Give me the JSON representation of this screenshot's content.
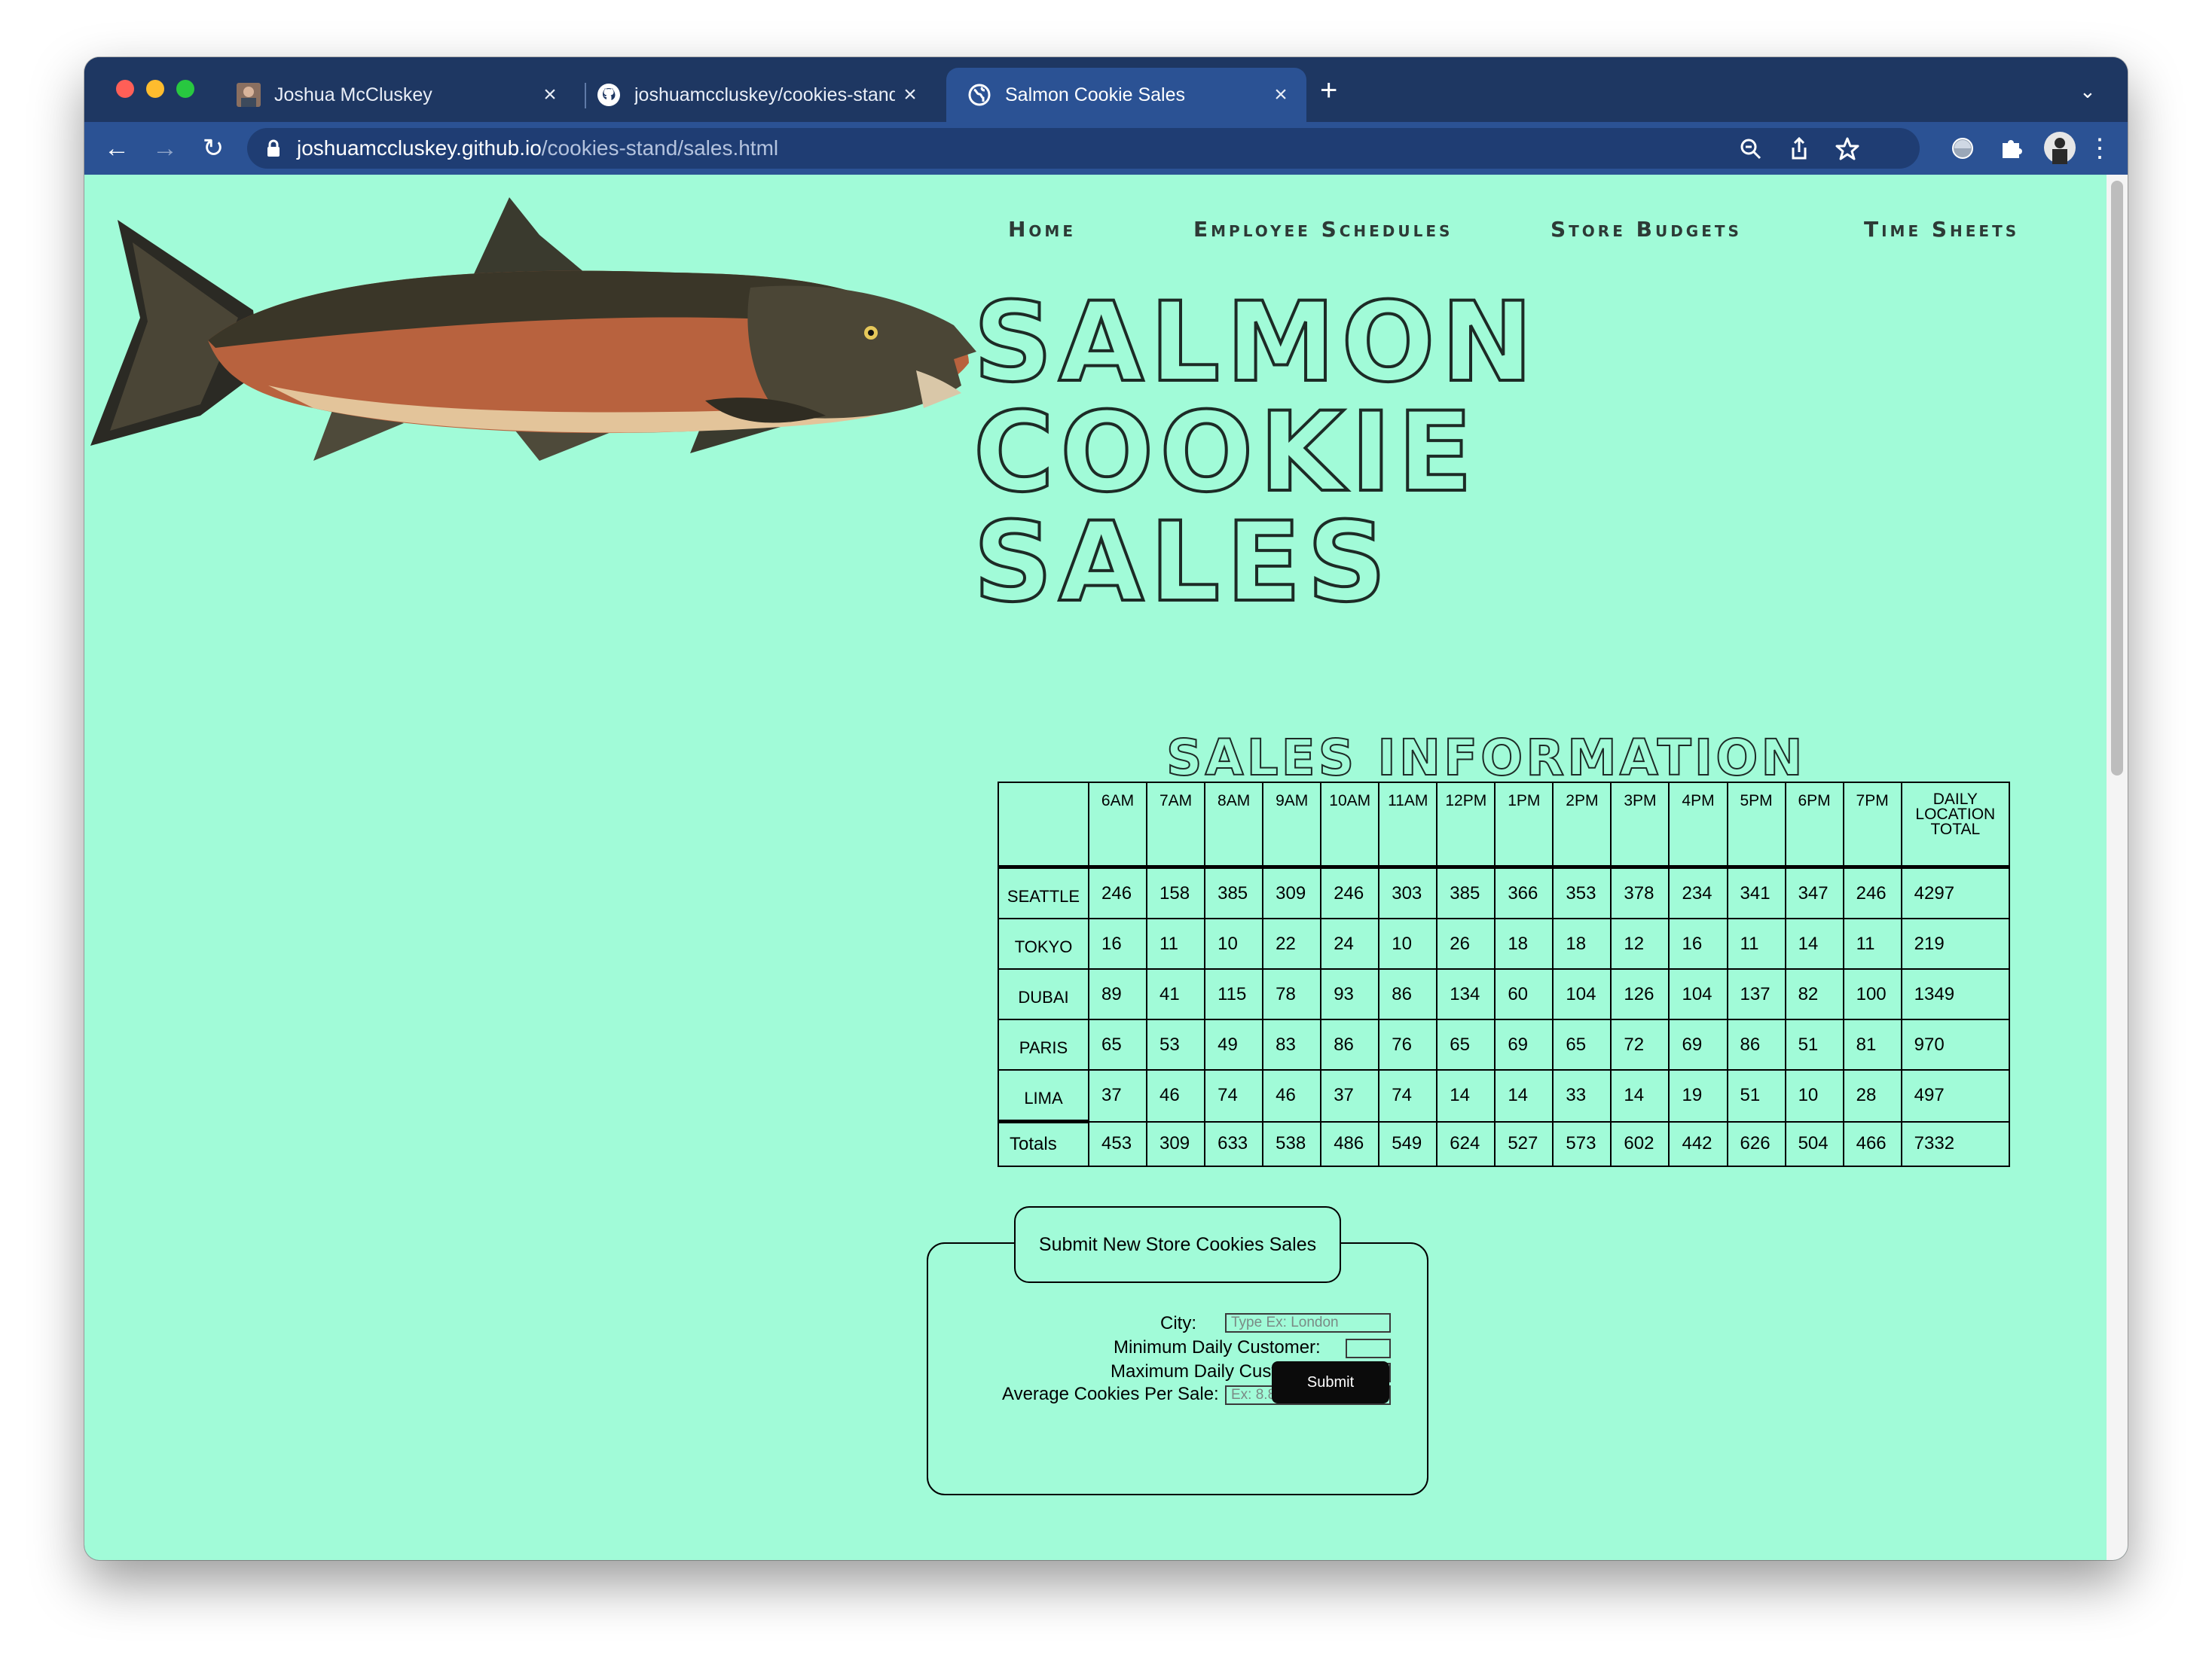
{
  "browser": {
    "tabs": [
      {
        "title": "Joshua McCluskey",
        "close": "×"
      },
      {
        "title": "joshuamccluskey/cookies-stand",
        "close": "×"
      },
      {
        "title": "Salmon Cookie Sales",
        "close": "×"
      }
    ],
    "new_tab": "+",
    "tab_menu": "⌄",
    "url_host": "joshuamccluskey.github.io",
    "url_path": "/cookies-stand/sales.html",
    "back": "←",
    "forward": "→",
    "reload": "↻",
    "menu": "⋮"
  },
  "nav": {
    "home": "Home",
    "employee_schedules": "Employee Schedules",
    "store_budgets": "Store Budgets",
    "time_sheets": "Time Sheets"
  },
  "hero": {
    "line1": "SALMON COOKIE",
    "line2": "SALES"
  },
  "sales": {
    "heading": "SALES INFORMATION",
    "hours": [
      "6AM",
      "7AM",
      "8AM",
      "9AM",
      "10AM",
      "11AM",
      "12PM",
      "1PM",
      "2PM",
      "3PM",
      "4PM",
      "5PM",
      "6PM",
      "7PM"
    ],
    "total_header": [
      "DAILY",
      "LOCATION",
      "TOTAL"
    ],
    "rows": [
      {
        "city": "SEATTLE",
        "values": [
          "246",
          "158",
          "385",
          "309",
          "246",
          "303",
          "385",
          "366",
          "353",
          "378",
          "234",
          "341",
          "347",
          "246"
        ],
        "total": "4297"
      },
      {
        "city": "TOKYO",
        "values": [
          "16",
          "11",
          "10",
          "22",
          "24",
          "10",
          "26",
          "18",
          "18",
          "12",
          "16",
          "11",
          "14",
          "11"
        ],
        "total": "219"
      },
      {
        "city": "DUBAI",
        "values": [
          "89",
          "41",
          "115",
          "78",
          "93",
          "86",
          "134",
          "60",
          "104",
          "126",
          "104",
          "137",
          "82",
          "100"
        ],
        "total": "1349"
      },
      {
        "city": "PARIS",
        "values": [
          "65",
          "53",
          "49",
          "83",
          "86",
          "76",
          "65",
          "69",
          "65",
          "72",
          "69",
          "86",
          "51",
          "81"
        ],
        "total": "970"
      },
      {
        "city": "LIMA",
        "values": [
          "37",
          "46",
          "74",
          "46",
          "37",
          "74",
          "14",
          "14",
          "33",
          "14",
          "19",
          "51",
          "10",
          "28"
        ],
        "total": "497"
      }
    ],
    "totals": {
      "label": "Totals",
      "values": [
        "453",
        "309",
        "633",
        "538",
        "486",
        "549",
        "624",
        "527",
        "573",
        "602",
        "442",
        "626",
        "504",
        "466"
      ],
      "grand": "7332"
    }
  },
  "form": {
    "legend": "Submit New Store Cookies Sales",
    "city_label": "City:",
    "city_placeholder": "Type Ex: London",
    "min_label": "Minimum Daily Customer:",
    "max_label": "Maximum Daily Customer:",
    "avg_label": "Average Cookies Per Sale:",
    "avg_placeholder": "Ex: 8.8",
    "submit": "Submit"
  },
  "colors": {
    "page_bg": "#a1fbd8",
    "browser_frame": "#1e3762",
    "active_tab": "#2b5294"
  }
}
